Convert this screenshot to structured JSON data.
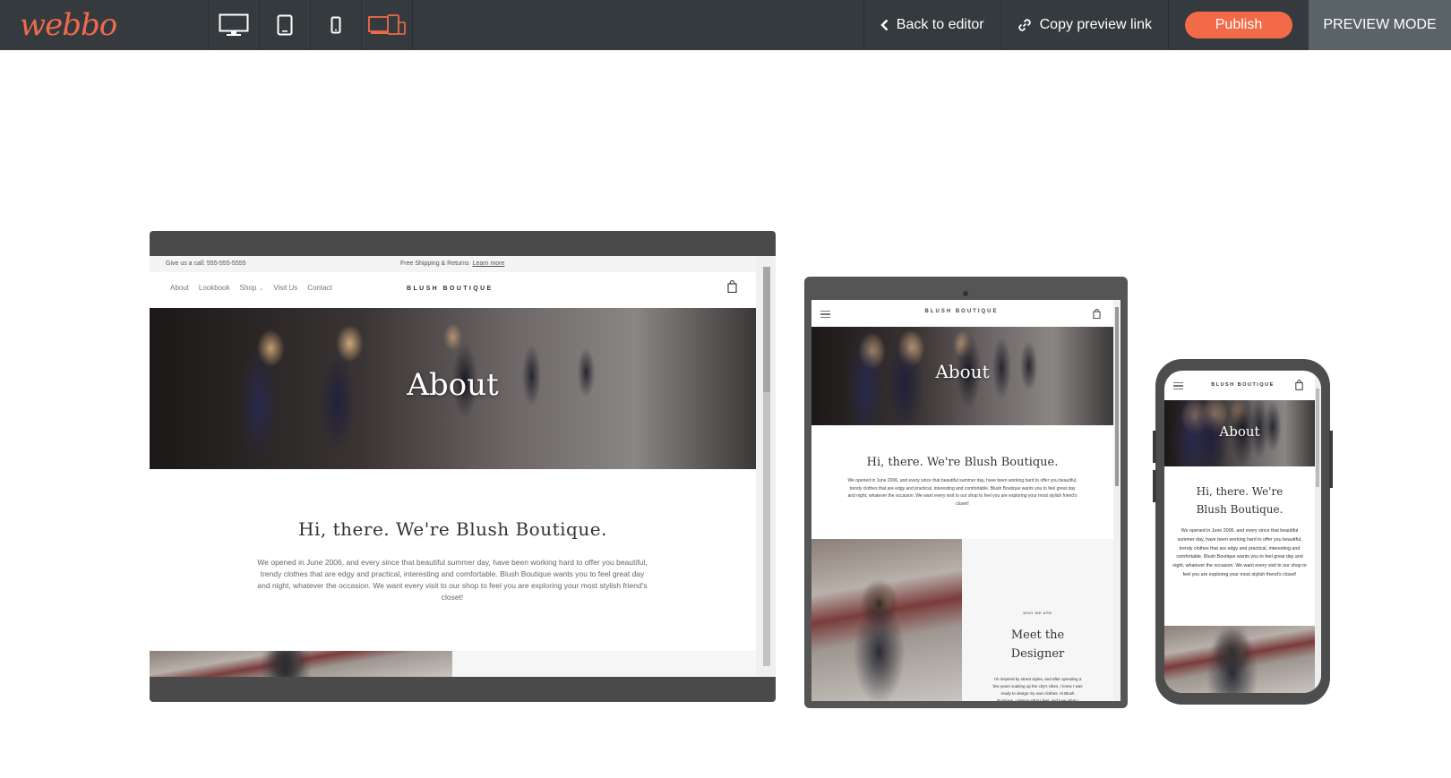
{
  "app": {
    "logo": "webbo",
    "devices": [
      "desktop",
      "tablet",
      "mobile",
      "all-devices"
    ],
    "active_device": "all-devices",
    "back_label": "Back to editor",
    "copy_label": "Copy preview link",
    "publish_label": "Publish",
    "mode_label": "PREVIEW MODE",
    "accent_color": "#f36a49"
  },
  "site": {
    "announce_call": "Give us a call: 555-555-5555",
    "announce_shipping": "Free Shipping & Returns",
    "announce_learn": "Learn more",
    "nav": [
      "About",
      "Lookbook",
      "Shop",
      "Visit Us",
      "Contact"
    ],
    "brand": "BLUSH BOUTIQUE",
    "hero_title": "About",
    "intro_heading": "Hi, there. We're Blush Boutique.",
    "intro_text": "We opened in June 2006, and every since that beautiful summer day, have been working hard to offer you beautiful, trendy clothes that are edgy and practical, interesting and comfortable. Blush Boutique wants you to feel great day and night, whatever the occasion. We want every visit to our shop to feel you are exploring your most stylish friend's closet!",
    "designer_kicker": "WHO WE ARE",
    "designer_heading": "Meet the Designer",
    "designer_text": "I'm inspired by street styles, and after spending a few years soaking up the city's vibes, I knew I was ready to design my own clothes. At Blush Boutique, I design what I feel, and love what I"
  }
}
